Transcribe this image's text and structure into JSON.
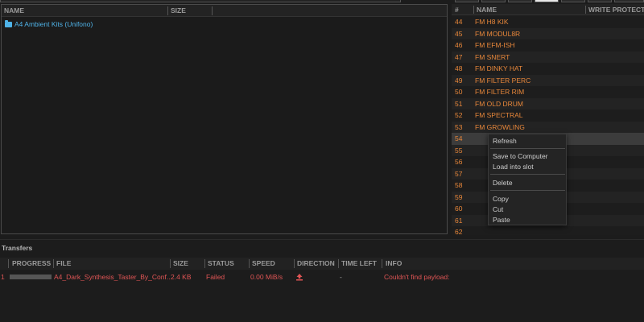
{
  "left_panel": {
    "columns": {
      "name": "NAME",
      "size": "SIZE"
    },
    "items": [
      {
        "name": "A4 Ambient Kits (Unifono)",
        "type": "folder"
      }
    ]
  },
  "right_panel": {
    "columns": {
      "num": "#",
      "name": "NAME",
      "write_protected": "WRITE PROTECTE"
    },
    "slots": [
      {
        "num": "44",
        "name": "FM H8 KIK"
      },
      {
        "num": "45",
        "name": "FM MODUL8R"
      },
      {
        "num": "46",
        "name": "FM EFM-ISH"
      },
      {
        "num": "47",
        "name": "FM SNERT"
      },
      {
        "num": "48",
        "name": "FM DINKY HAT"
      },
      {
        "num": "49",
        "name": "FM FILTER PERC"
      },
      {
        "num": "50",
        "name": "FM FILTER RIM"
      },
      {
        "num": "51",
        "name": "FM OLD DRUM"
      },
      {
        "num": "52",
        "name": "FM SPECTRAL"
      },
      {
        "num": "53",
        "name": "FM GROWLING"
      },
      {
        "num": "54",
        "name": ""
      },
      {
        "num": "55",
        "name": ""
      },
      {
        "num": "56",
        "name": ""
      },
      {
        "num": "57",
        "name": ""
      },
      {
        "num": "58",
        "name": ""
      },
      {
        "num": "59",
        "name": ""
      },
      {
        "num": "60",
        "name": ""
      },
      {
        "num": "61",
        "name": ""
      },
      {
        "num": "62",
        "name": ""
      }
    ],
    "selected_num": "54"
  },
  "context_menu": {
    "refresh": "Refresh",
    "save_to_computer": "Save to Computer",
    "load_into_slot": "Load into slot",
    "delete": "Delete",
    "copy": "Copy",
    "cut": "Cut",
    "paste": "Paste"
  },
  "transfers": {
    "title": "Transfers",
    "columns": {
      "progress": "PROGRESS",
      "file": "FILE",
      "size": "SIZE",
      "status": "STATUS",
      "speed": "SPEED",
      "direction": "DIRECTION",
      "time_left": "TIME LEFT",
      "info": "INFO"
    },
    "rows": [
      {
        "index": "1",
        "file": "A4_Dark_Synthesis_Taster_By_Conf...",
        "size": "2.4 KB",
        "status": "Failed",
        "speed": "0.00 MiB/s",
        "direction_icon": "upload-icon",
        "time_left": "-",
        "info": "Couldn't find payload:"
      }
    ]
  },
  "colors": {
    "background": "#1c1c1c",
    "slot_text": "#e8873a",
    "folder": "#4fb3e8",
    "error": "#e05555"
  }
}
